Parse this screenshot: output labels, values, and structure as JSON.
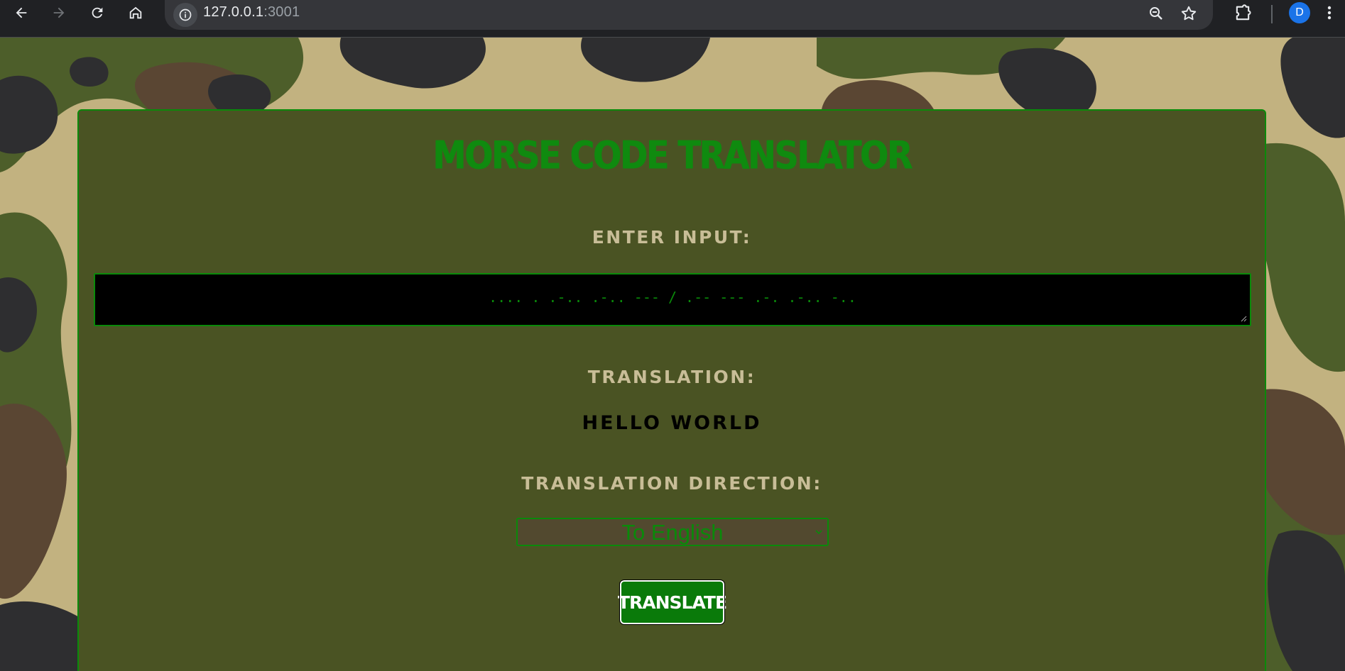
{
  "browser": {
    "url_host": "127.0.0.1",
    "url_port": ":3001",
    "profile_initial": "D",
    "icons": [
      "back-icon",
      "forward-icon",
      "reload-icon",
      "home-icon",
      "site-info-icon",
      "zoom-icon",
      "star-icon",
      "extensions-icon",
      "menu-icon"
    ]
  },
  "app": {
    "title": "MORSE CODE TRANSLATOR",
    "input_label": "ENTER INPUT:",
    "input_value": ".... . .-.. .-.. --- / .-- --- .-. .-.. -..",
    "translation_label": "TRANSLATION:",
    "translation_value": "HELLO WORLD",
    "direction_label": "TRANSLATION DIRECTION:",
    "direction_selected": "To English",
    "translate_button": "TRANSLATE"
  },
  "colors": {
    "camo_tan": "#c2b280",
    "camo_green": "#4d5e2a",
    "camo_brown": "#5a4633",
    "camo_dark": "#2e2e30",
    "card_bg": "#4a5323",
    "accent_green": "#0a8a0a"
  }
}
